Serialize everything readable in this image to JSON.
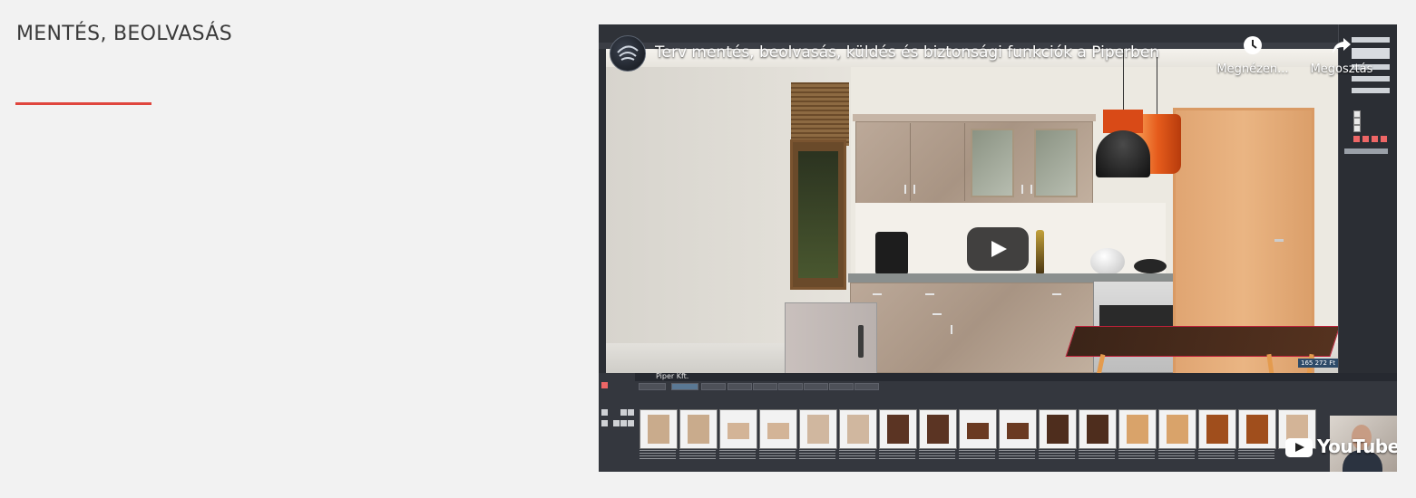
{
  "section": {
    "title": "MENTÉS, BEOLVASÁS",
    "accent_color": "#e0463e"
  },
  "video": {
    "title": "Terv mentés, beolvasás, küldés és biztonsági funkciók a Piperben",
    "watch_later_label": "Megnézen...",
    "share_label": "Megosztás",
    "watch_later_icon": "clock-icon",
    "share_icon": "share-arrow-icon",
    "play_icon": "play-icon",
    "brand_label": "YouTube",
    "app": {
      "library_title": "Piper Kft.",
      "price": "165 272 Ft"
    }
  }
}
